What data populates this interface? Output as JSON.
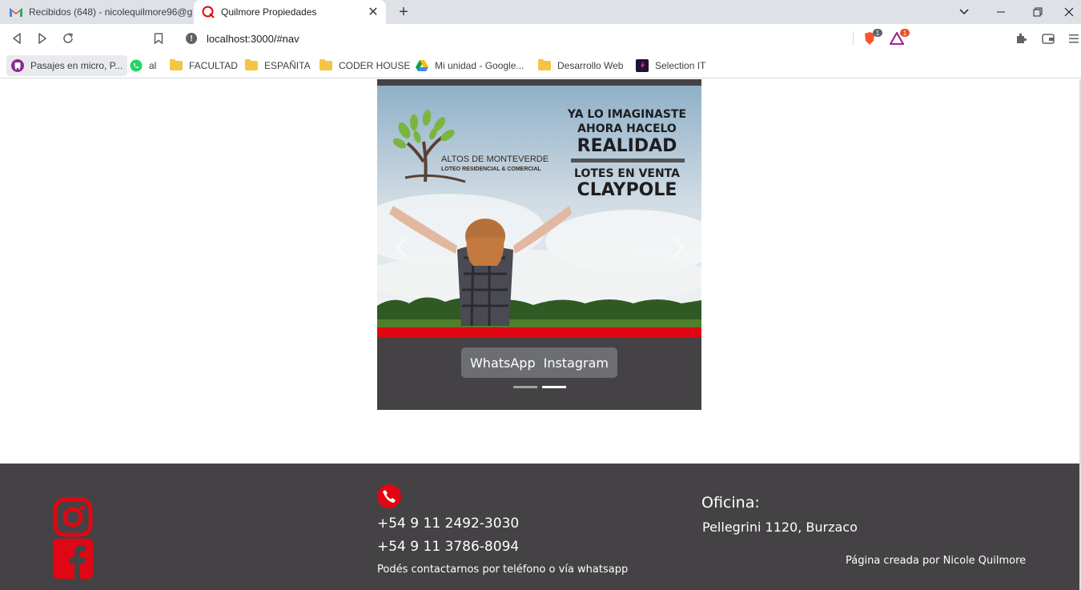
{
  "browser": {
    "tabs": [
      {
        "title": "Recibidos (648) - nicolequilmore96@g",
        "active": false,
        "icon": "gmail-icon"
      },
      {
        "title": "Quilmore Propiedades",
        "active": true,
        "icon": "quilmore-icon"
      }
    ],
    "url": "localhost:3000/#nav",
    "brave_badge": "1",
    "rewards_badge": "1",
    "bookmarks": [
      {
        "label": "Pasajes en micro, P...",
        "icon": "bus-icon"
      },
      {
        "label": "al",
        "icon": "whatsapp-icon"
      },
      {
        "label": "FACULTAD",
        "icon": "folder-icon"
      },
      {
        "label": "ESPAÑITA",
        "icon": "folder-icon"
      },
      {
        "label": "CODER HOUSE",
        "icon": "folder-icon"
      },
      {
        "label": "Mi unidad - Google...",
        "icon": "drive-icon"
      },
      {
        "label": "Desarrollo Web",
        "icon": "folder-icon"
      },
      {
        "label": "Selection IT",
        "icon": "selection-icon"
      }
    ]
  },
  "carousel": {
    "slide": {
      "brand_line1": "ALTOS DE MONTEVERDE",
      "brand_line2": "LOTEO RESIDENCIAL & COMERCIAL",
      "headline1": "YA LO IMAGINASTE",
      "headline2": "AHORA HACELO",
      "headline3": "REALIDAD",
      "headline4": "LOTES EN VENTA",
      "headline5": "CLAYPOLE"
    },
    "caption_whatsapp": "WhatsApp",
    "caption_instagram": "Instagram",
    "active_indicator": 2,
    "indicator_count": 2
  },
  "footer": {
    "phone1": "+54 9 11 2492-3030",
    "phone2": "+54 9 11 3786-8094",
    "contact_note": "Podés contactarnos por teléfono o vía whatsapp",
    "office_title": "Oficina:",
    "office_address": "Pellegrini 1120, Burzaco",
    "credit": "Página creada por Nicole Quilmore"
  },
  "colors": {
    "footer_bg": "#444244",
    "accent_red": "#e10613",
    "tab_bar": "#dee1e6"
  }
}
